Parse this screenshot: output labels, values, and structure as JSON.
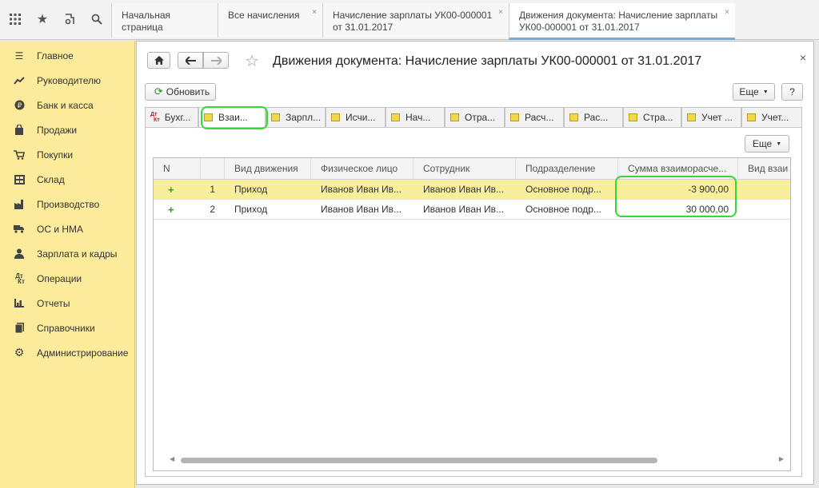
{
  "topbar": {
    "icons": [
      "apps-icon",
      "star-icon",
      "history-icon",
      "search-icon"
    ],
    "tabs": [
      {
        "label": "Начальная страница",
        "closable": false
      },
      {
        "label": "Все начисления",
        "closable": true
      },
      {
        "label": "Начисление зарплаты УК00-000001 от 31.01.2017",
        "closable": true
      },
      {
        "label": "Движения документа: Начисление зарплаты УК00-000001 от 31.01.2017",
        "closable": true,
        "active": true
      }
    ]
  },
  "sidebar": {
    "items": [
      {
        "label": "Главное",
        "icon": "menu-icon"
      },
      {
        "label": "Руководителю",
        "icon": "trend-icon"
      },
      {
        "label": "Банк и касса",
        "icon": "coin-icon"
      },
      {
        "label": "Продажи",
        "icon": "bag-icon"
      },
      {
        "label": "Покупки",
        "icon": "cart-icon"
      },
      {
        "label": "Склад",
        "icon": "warehouse-icon"
      },
      {
        "label": "Производство",
        "icon": "factory-icon"
      },
      {
        "label": "ОС и НМА",
        "icon": "truck-icon"
      },
      {
        "label": "Зарплата и кадры",
        "icon": "person-icon"
      },
      {
        "label": "Операции",
        "icon": "dt-kt-icon"
      },
      {
        "label": "Отчеты",
        "icon": "bar-chart-icon"
      },
      {
        "label": "Справочники",
        "icon": "book-icon"
      },
      {
        "label": "Администрирование",
        "icon": "gear-icon"
      }
    ]
  },
  "window": {
    "title": "Движения документа: Начисление зарплаты УК00-000001 от 31.01.2017",
    "refresh_label": "Обновить",
    "more_label": "Еще",
    "help_label": "?",
    "close_label": "×"
  },
  "subtabs": [
    {
      "label": "Бухг...",
      "icon": "dt-kt-icon"
    },
    {
      "label": "Взаи...",
      "active": true
    },
    {
      "label": "Зарпл..."
    },
    {
      "label": "Исчи..."
    },
    {
      "label": "Нач..."
    },
    {
      "label": "Отра..."
    },
    {
      "label": "Расч..."
    },
    {
      "label": "Рас..."
    },
    {
      "label": "Стра..."
    },
    {
      "label": "Учет ..."
    },
    {
      "label": "Учет..."
    }
  ],
  "table": {
    "more_label": "Еще",
    "columns": [
      "N",
      "",
      "Вид движения",
      "Физическое лицо",
      "Сотрудник",
      "Подразделение",
      "Сумма взаиморасче...",
      "Вид взаи"
    ],
    "rows": [
      {
        "marker": "+",
        "n": "1",
        "movement": "Приход",
        "person": "Иванов Иван Ив...",
        "employee": "Иванов Иван Ив...",
        "department": "Основное подр...",
        "amount": "-3 900,00",
        "kind": ""
      },
      {
        "marker": "+",
        "n": "2",
        "movement": "Приход",
        "person": "Иванов Иван Ив...",
        "employee": "Иванов Иван Ив...",
        "department": "Основное подр...",
        "amount": "30 000,00",
        "kind": ""
      }
    ]
  },
  "colors": {
    "sidebar_bg": "#fbeb9a",
    "selected_row": "#f9ee9b",
    "highlight": "#35d835",
    "plus_green": "#2a9b2a"
  }
}
